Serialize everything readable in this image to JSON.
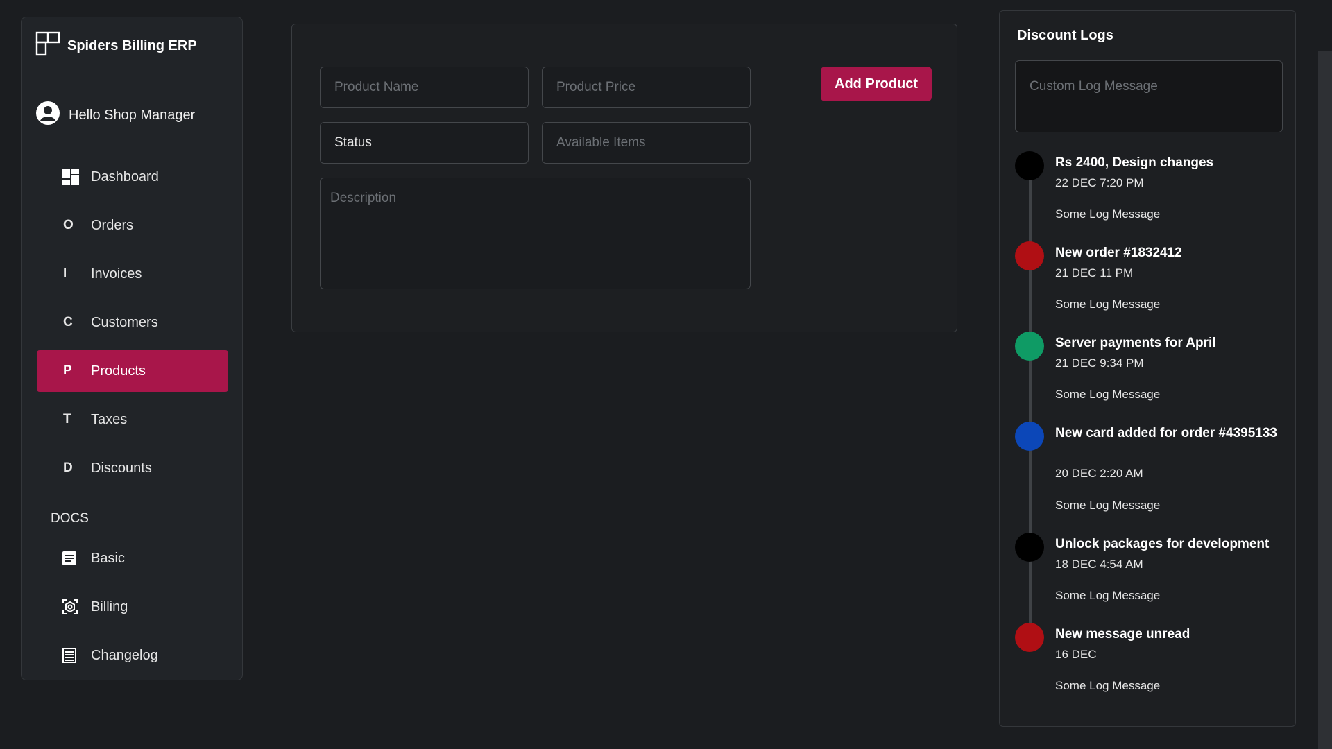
{
  "app": {
    "brand": "Spiders Billing ERP",
    "greeting": "Hello Shop Manager"
  },
  "nav": [
    {
      "letter": "",
      "label": "Dashboard",
      "icon": "dashboard-icon"
    },
    {
      "letter": "O",
      "label": "Orders"
    },
    {
      "letter": "I",
      "label": "Invoices"
    },
    {
      "letter": "C",
      "label": "Customers"
    },
    {
      "letter": "P",
      "label": "Products",
      "active": true
    },
    {
      "letter": "T",
      "label": "Taxes"
    },
    {
      "letter": "D",
      "label": "Discounts"
    }
  ],
  "docs": {
    "title": "DOCS",
    "items": [
      {
        "label": "Basic",
        "icon": "document-icon"
      },
      {
        "label": "Billing",
        "icon": "billing-icon"
      },
      {
        "label": "Changelog",
        "icon": "list-icon"
      }
    ]
  },
  "form": {
    "product_name_placeholder": "Product Name",
    "product_price_placeholder": "Product Price",
    "status_value": "Status",
    "available_items_placeholder": "Available Items",
    "description_placeholder": "Description",
    "add_button": "Add Product"
  },
  "logs": {
    "title": "Discount Logs",
    "custom_placeholder": "Custom Log Message",
    "entries": [
      {
        "title": "Rs 2400, Design changes",
        "date": "22 DEC 7:20 PM",
        "message": "Some Log Message",
        "color": "#000000"
      },
      {
        "title": "New order #1832412",
        "date": "21 DEC 11 PM",
        "message": "Some Log Message",
        "color": "#b00f14"
      },
      {
        "title": "Server payments for April",
        "date": "21 DEC 9:34 PM",
        "message": "Some Log Message",
        "color": "#0f9b65"
      },
      {
        "title": "New card added for order #4395133",
        "date": "20 DEC 2:20 AM",
        "message": "Some Log Message",
        "color": "#0c47b8"
      },
      {
        "title": "Unlock packages for development",
        "date": "18 DEC 4:54 AM",
        "message": "Some Log Message",
        "color": "#000000"
      },
      {
        "title": "New message unread",
        "date": "16 DEC",
        "message": "Some Log Message",
        "color": "#b00f14"
      }
    ]
  },
  "colors": {
    "accent": "#a8164a",
    "background": "#1b1d20",
    "panel": "#212428"
  }
}
